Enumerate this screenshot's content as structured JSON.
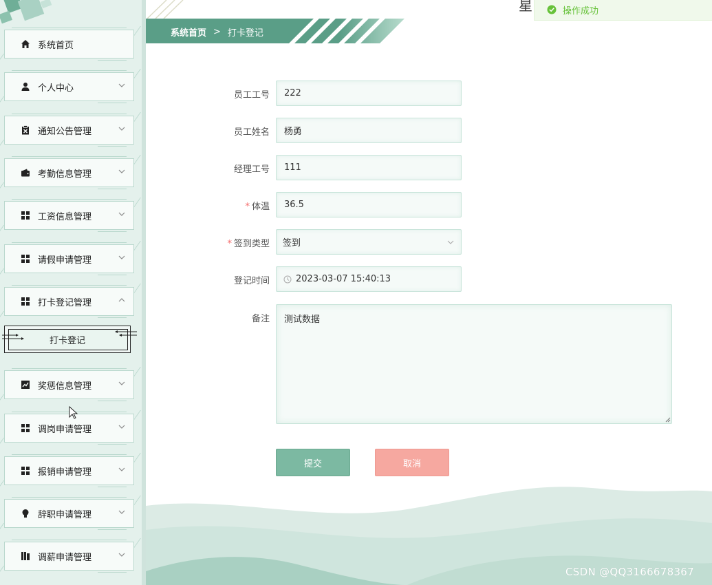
{
  "sidebar": {
    "items": [
      {
        "label": "系统首页",
        "icon": "home-icon",
        "arrow": "none"
      },
      {
        "label": "个人中心",
        "icon": "user-icon",
        "arrow": "down"
      },
      {
        "label": "通知公告管理",
        "icon": "clipboard-icon",
        "arrow": "down"
      },
      {
        "label": "考勤信息管理",
        "icon": "wallet-icon",
        "arrow": "down"
      },
      {
        "label": "工资信息管理",
        "icon": "grid-icon",
        "arrow": "down"
      },
      {
        "label": "请假申请管理",
        "icon": "grid-icon",
        "arrow": "down"
      },
      {
        "label": "打卡登记管理",
        "icon": "grid-icon",
        "arrow": "up"
      },
      {
        "label": "奖惩信息管理",
        "icon": "chart-icon",
        "arrow": "down"
      },
      {
        "label": "调岗申请管理",
        "icon": "grid-icon",
        "arrow": "down"
      },
      {
        "label": "报销申请管理",
        "icon": "grid-icon",
        "arrow": "down"
      },
      {
        "label": "辞职申请管理",
        "icon": "bulb-icon",
        "arrow": "down"
      },
      {
        "label": "调薪申请管理",
        "icon": "book-icon",
        "arrow": "down"
      }
    ],
    "submenu": {
      "label": "打卡登记"
    }
  },
  "breadcrumb": {
    "home": "系统首页",
    "separator": ">",
    "current": "打卡登记"
  },
  "header": {
    "partial_char": "星"
  },
  "toast": {
    "message": "操作成功",
    "icon": "check-circle-icon",
    "color": "#67c23a"
  },
  "form": {
    "employee_id": {
      "label": "员工工号",
      "value": "222",
      "required": false
    },
    "employee_name": {
      "label": "员工姓名",
      "value": "杨勇",
      "required": false
    },
    "manager_id": {
      "label": "经理工号",
      "value": "111",
      "required": false
    },
    "temperature": {
      "label": "体温",
      "value": "36.5",
      "required": true
    },
    "checkin_type": {
      "label": "签到类型",
      "value": "签到",
      "required": true
    },
    "register_time": {
      "label": "登记时间",
      "value": "2023-03-07 15:40:13",
      "required": false
    },
    "remark": {
      "label": "备注",
      "value": "测试数据",
      "required": false
    },
    "required_mark": "*",
    "submit_label": "提交",
    "cancel_label": "取消"
  },
  "watermark": "CSDN @QQ3166678367",
  "colors": {
    "primary": "#5a9e87",
    "submit": "#7cb9a2",
    "cancel": "#f6a8a0",
    "sidebar_bg": "#e4f1ec",
    "wave": "#cfe5dd"
  }
}
